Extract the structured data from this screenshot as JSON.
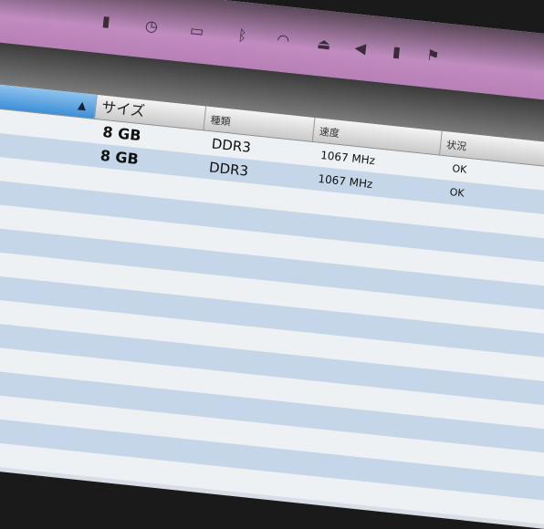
{
  "menubar": {
    "icons": [
      "app-icon",
      "clock-icon",
      "display-icon",
      "bluetooth-icon",
      "wifi-icon",
      "eject-icon",
      "volume-icon",
      "app-icon",
      "flag-icon"
    ]
  },
  "table": {
    "headers": [
      "サイズ",
      "種類",
      "速度",
      "状況"
    ],
    "rows": [
      {
        "size": "8 GB",
        "type": "DDR3",
        "speed": "1067 MHz",
        "status": "OK"
      },
      {
        "size": "8 GB",
        "type": "DDR3",
        "speed": "1067 MHz",
        "status": "OK"
      }
    ]
  }
}
